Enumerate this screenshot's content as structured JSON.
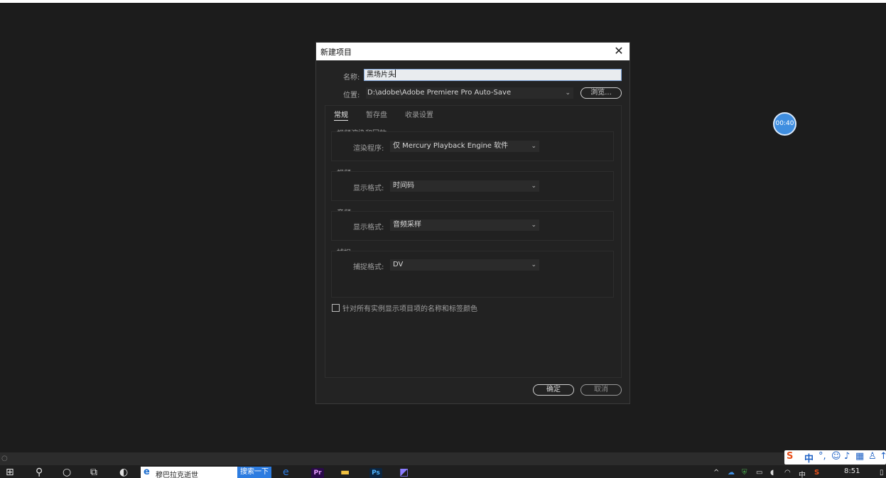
{
  "dialog": {
    "title": "新建项目",
    "close_glyph": "✕",
    "name_label": "名称:",
    "name_value": "黑场片头",
    "location_label": "位置:",
    "location_value": "D:\\adobe\\Adobe Premiere Pro Auto-Save",
    "browse_label": "浏览...",
    "tabs": [
      "常规",
      "暂存盘",
      "收录设置"
    ],
    "groups": {
      "render": {
        "title": "视频渲染和回放",
        "field_label": "渲染程序:",
        "field_value": "仅 Mercury Playback Engine 软件"
      },
      "video": {
        "title": "视频",
        "field_label": "显示格式:",
        "field_value": "时间码"
      },
      "audio": {
        "title": "音频",
        "field_label": "显示格式:",
        "field_value": "音频采样"
      },
      "capture": {
        "title": "捕捉",
        "field_label": "捕捉格式:",
        "field_value": "DV"
      }
    },
    "checkbox_label": "针对所有实例显示项目项的名称和标签颜色",
    "ok_label": "确定",
    "cancel_label": "取消"
  },
  "overlay_timer": "00:40",
  "taskbar": {
    "search_text": "穆巴拉克逝世",
    "search_button": "搜索一下",
    "clock": "8:51",
    "apps": {
      "premiere": "Pr",
      "photoshop": "Ps"
    },
    "tray_lang": "中"
  },
  "ime": {
    "lang": "中",
    "punct": "°,"
  },
  "colors": {
    "accent": "#3f8ee0",
    "premiere": "#2a0a4a",
    "photoshop": "#0b2540"
  }
}
